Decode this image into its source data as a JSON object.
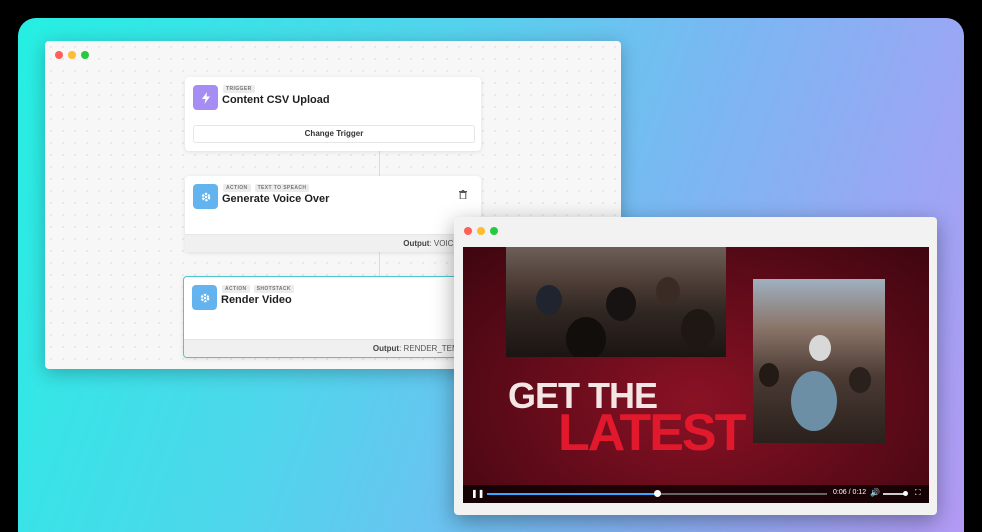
{
  "workflow": {
    "trigger_card": {
      "tag": "TRIGGER",
      "title": "Content CSV Upload",
      "button_label": "Change Trigger"
    },
    "voice_card": {
      "tags": [
        "ACTION",
        "TEXT TO SPEACH"
      ],
      "title": "Generate Voice Over",
      "output_label": "Output",
      "output_value": ": VOICEO"
    },
    "render_card": {
      "tags": [
        "ACTION",
        "SHOTSTACK"
      ],
      "title": "Render Video",
      "output_label": "Output",
      "output_value": ": RENDER_TEMP"
    },
    "icons": {
      "trigger": "lightning-icon",
      "action": "gear-icon",
      "delete": "trash-icon"
    }
  },
  "video": {
    "headline_line1": "GET THE",
    "headline_line2": "LATEST",
    "player": {
      "time": "0:06 / 0:12",
      "progress": 0.5,
      "volume": 0.9
    }
  },
  "colors": {
    "accent_selected": "#4fc6cf",
    "trigger_icon": "#a58df3",
    "action_icon": "#63b4ee",
    "headline_red": "#e2182c",
    "progress_blue": "#39a7ff"
  }
}
